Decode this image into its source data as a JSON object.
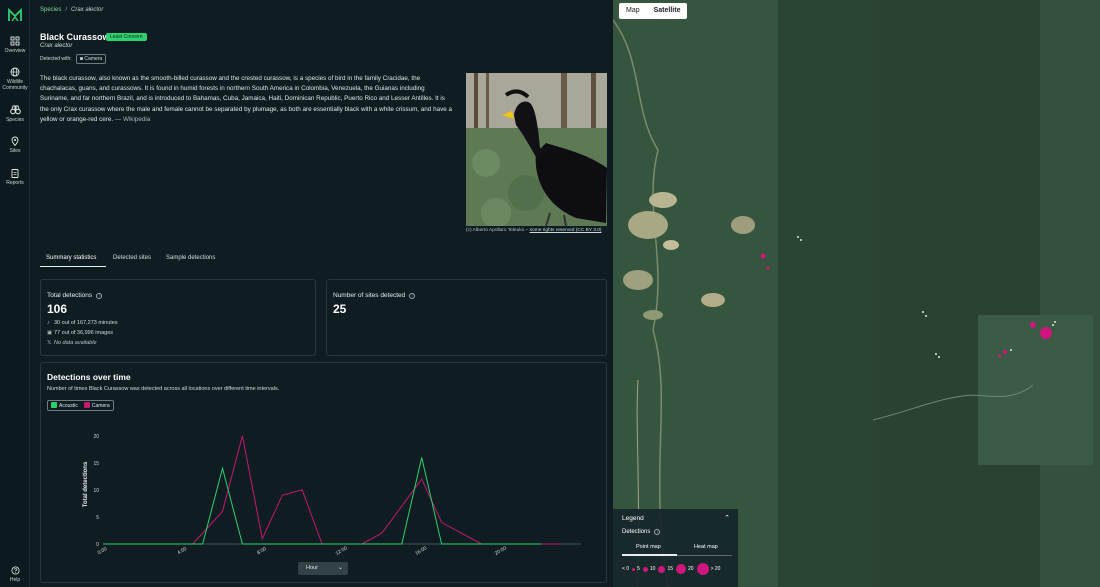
{
  "sidebar": {
    "items": [
      {
        "label": "Overview",
        "icon": "grid-icon"
      },
      {
        "label": "Wildlife Community",
        "icon": "globe-icon"
      },
      {
        "label": "Species",
        "icon": "binoculars-icon"
      },
      {
        "label": "Sites",
        "icon": "map-pin-icon"
      },
      {
        "label": "Reports",
        "icon": "clipboard-icon"
      }
    ],
    "help_label": "Help"
  },
  "breadcrumb": {
    "root": "Species",
    "separator": "/",
    "current": "Crax alector"
  },
  "species": {
    "common_name": "Black Curassow",
    "status": "Least Concern",
    "scientific_name": "Crax alector",
    "detected_with_label": "Detected with:",
    "detected_with_value": "Camera",
    "description": "The black curassow, also known as the smooth-billed curassow and the crested curassow, is a species of bird in the family Cracidae, the chachalacas, guans, and curassows. It is found in humid forests in northern South America in Colombia, Venezuela, the Guianas including Suriname, and far northern Brazil, and is introduced to Bahamas, Cuba, Jamaica, Haiti, Dominican Republic, Puerto Rico and Lesser Antilles. It is the only Crax curassow where the male and female cannot be separated by plumage, as both are essentially black with a white crissum, and have a yellow or orange-red cere.",
    "source": "— Wikipedia",
    "photo_credit_prefix": "(c) Alberto Apollaro Teleuko – ",
    "photo_credit_link": "some rights reserved (CC BY 3.0)"
  },
  "tabs": [
    "Summary statistics",
    "Detected sites",
    "Sample detections"
  ],
  "summary": {
    "total_detections_label": "Total detections",
    "total_detections": "106",
    "lines": [
      {
        "icon": "microphone-icon",
        "text": "30 out of 167,273 minutes",
        "italic": false
      },
      {
        "icon": "camera-icon",
        "text": "77 out of 36,996 images",
        "italic": false
      },
      {
        "icon": "x-icon",
        "text": "No data available",
        "italic": true
      }
    ],
    "sites_label": "Number of sites detected",
    "sites_value": "25"
  },
  "detections_chart": {
    "title": "Detections over time",
    "subtitle": "Number of times Black Curassow was detected across all locations over different time intervals.",
    "select_value": "Hour"
  },
  "chart_data": {
    "type": "line",
    "ylabel": "Total detections",
    "xlabel": "",
    "x": [
      0,
      1,
      2,
      3,
      4,
      5,
      6,
      7,
      8,
      9,
      10,
      11,
      12,
      13,
      14,
      15,
      16,
      17,
      18,
      19,
      20,
      21,
      22,
      23
    ],
    "xticks": [
      0,
      4,
      8,
      12,
      16,
      20
    ],
    "xtick_labels": [
      "0:00",
      "4:00",
      "8:00",
      "12:00",
      "16:00",
      "20:00"
    ],
    "yticks": [
      0,
      5,
      10,
      15,
      20
    ],
    "ylim": [
      0,
      22
    ],
    "grid": false,
    "legend": "top-left",
    "series": [
      {
        "name": "Acoustic",
        "color": "#2fd06f",
        "values": [
          0,
          0,
          0,
          0,
          0,
          0,
          0,
          0,
          0,
          0,
          0,
          0,
          0,
          0,
          0,
          0,
          0,
          0,
          0,
          0,
          0,
          0,
          0,
          0
        ],
        "points": [
          [
            0,
            0
          ],
          [
            5,
            0
          ],
          [
            6,
            14
          ],
          [
            7,
            0
          ],
          [
            14,
            0
          ],
          [
            15,
            0
          ],
          [
            16,
            16
          ],
          [
            17,
            0
          ],
          [
            22,
            0
          ]
        ]
      },
      {
        "name": "Camera",
        "color": "#c2186d",
        "points": [
          [
            0,
            0
          ],
          [
            4.5,
            0
          ],
          [
            6,
            6
          ],
          [
            7,
            20
          ],
          [
            8,
            1
          ],
          [
            9,
            9
          ],
          [
            10,
            10
          ],
          [
            11,
            0
          ],
          [
            12,
            0
          ],
          [
            13,
            0
          ],
          [
            14,
            2
          ],
          [
            15,
            7
          ],
          [
            16,
            12
          ],
          [
            17,
            4
          ],
          [
            18,
            2
          ],
          [
            19,
            0
          ],
          [
            23,
            0
          ]
        ]
      }
    ]
  },
  "map": {
    "toggle": [
      "Map",
      "Satellite"
    ],
    "active": "Satellite",
    "legend_title": "Legend",
    "detections_label": "Detections",
    "tabs": [
      "Point map",
      "Heat map"
    ],
    "scale_labels": [
      "< 0",
      "5",
      "10",
      "15",
      "20",
      "> 20"
    ],
    "accent": "#d0157e"
  }
}
